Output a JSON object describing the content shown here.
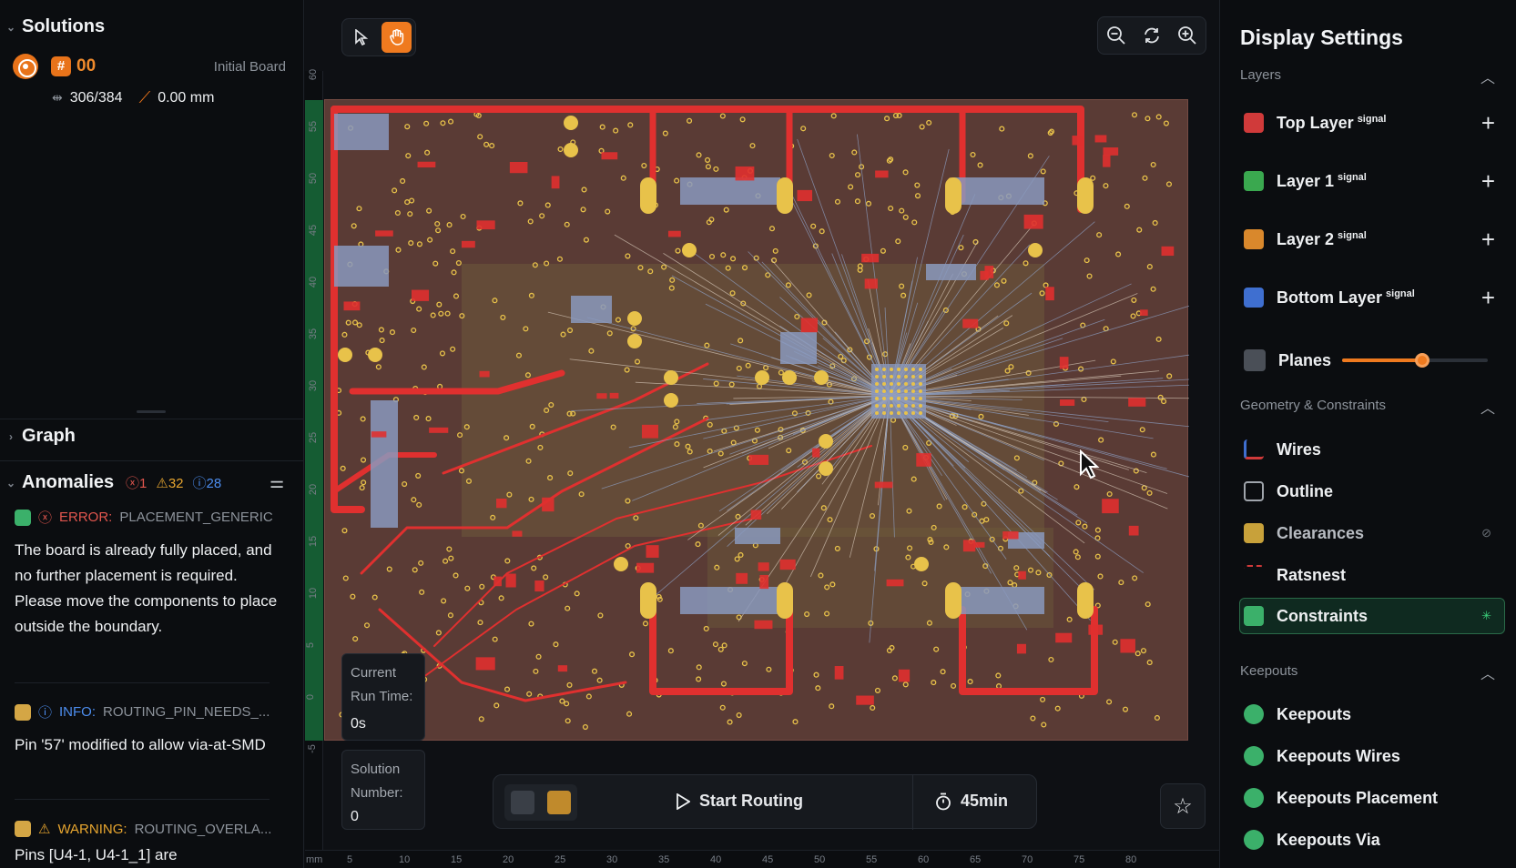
{
  "solutions": {
    "title": "Solutions",
    "item": {
      "number": "00",
      "label": "Initial Board",
      "connections": "306/384",
      "length": "0.00 mm"
    }
  },
  "graph": {
    "title": "Graph"
  },
  "anomalies": {
    "title": "Anomalies",
    "counts": {
      "errors": "1",
      "warnings": "32",
      "infos": "28"
    },
    "items": [
      {
        "kind": "ERROR:",
        "code": "PLACEMENT_GENERIC",
        "body": "The board is already fully placed, and no further placement is required. Please move the components to place outside the boundary."
      },
      {
        "kind": "INFO:",
        "code": "ROUTING_PIN_NEEDS_...",
        "body": "Pin '57' modified to allow via-at-SMD"
      },
      {
        "kind": "WARNING:",
        "code": "ROUTING_OVERLA...",
        "body": "Pins [U4-1, U4-1_1] are"
      }
    ]
  },
  "canvas": {
    "ruler_unit": "mm",
    "x_ticks": [
      "5",
      "10",
      "15",
      "20",
      "25",
      "30",
      "35",
      "40",
      "45",
      "50",
      "55",
      "60",
      "65",
      "70",
      "75",
      "80"
    ],
    "y_ticks": [
      "60",
      "55",
      "50",
      "45",
      "40",
      "35",
      "30",
      "25",
      "20",
      "15",
      "10",
      "5",
      "0",
      "-5"
    ],
    "run_time": {
      "label": "Current Run Time:",
      "value": "0s"
    },
    "solution_number": {
      "label": "Solution Number:",
      "value": "0"
    },
    "start_routing": "Start Routing",
    "timer": "45min"
  },
  "display_settings": {
    "title": "Display Settings",
    "layers_title": "Layers",
    "layers": [
      {
        "label": "Top Layer",
        "tag": "signal",
        "color": "#d03a3a"
      },
      {
        "label": "Layer 1",
        "tag": "signal",
        "color": "#3aa84f"
      },
      {
        "label": "Layer 2",
        "tag": "signal",
        "color": "#d9882c"
      },
      {
        "label": "Bottom Layer",
        "tag": "signal",
        "color": "#3f6fd0"
      }
    ],
    "planes": {
      "label": "Planes",
      "value": 0.6
    },
    "geometry_title": "Geometry & Constraints",
    "geometry": [
      "Wires",
      "Outline",
      "Clearances",
      "Ratsnest",
      "Constraints"
    ],
    "keepouts_title": "Keepouts",
    "keepouts": [
      "Keepouts",
      "Keepouts Wires",
      "Keepouts Placement",
      "Keepouts Via"
    ]
  },
  "colors": {
    "accent": "#ef7a1f",
    "board": "#5a3b35",
    "trace_red": "#e0302f",
    "pad_yellow": "#e8c24a",
    "component_blue": "#8a99bd"
  }
}
